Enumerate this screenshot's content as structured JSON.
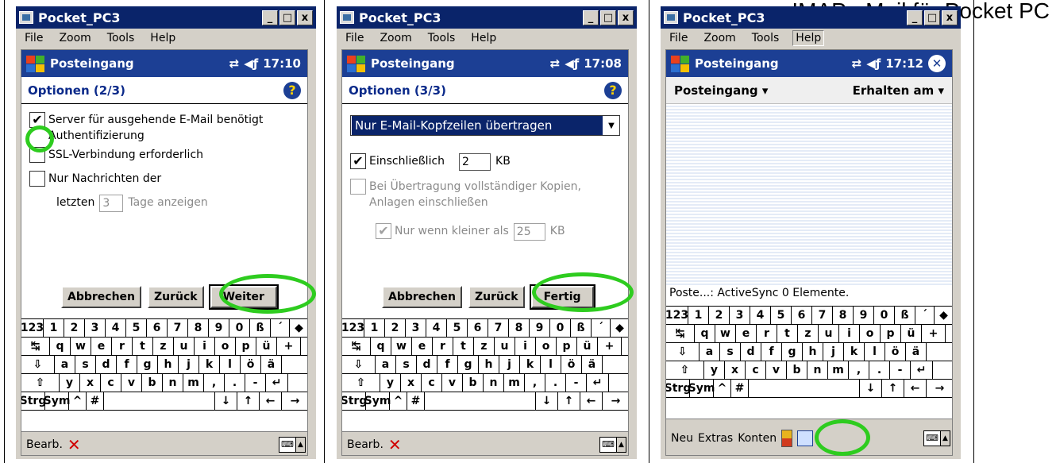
{
  "headline": "IMAP - Mail für Pocket PC",
  "window_title": "Pocket_PC3",
  "menu": [
    "File",
    "Zoom",
    "Tools",
    "Help"
  ],
  "win_buttons": [
    "_",
    "□",
    "x"
  ],
  "app": "Posteingang",
  "help_glyph": "?",
  "close_glyph": "✕",
  "keyboard": {
    "row1": [
      "123",
      "1",
      "2",
      "3",
      "4",
      "5",
      "6",
      "7",
      "8",
      "9",
      "0",
      "ß",
      "´",
      "◆"
    ],
    "row2": [
      "↹",
      "q",
      "w",
      "e",
      "r",
      "t",
      "z",
      "u",
      "i",
      "o",
      "p",
      "ü",
      "+"
    ],
    "row3": [
      "⇩",
      "a",
      "s",
      "d",
      "f",
      "g",
      "h",
      "j",
      "k",
      "l",
      "ö",
      "ä"
    ],
    "row4": [
      "⇧",
      "y",
      "x",
      "c",
      "v",
      "b",
      "n",
      "m",
      ",",
      ".",
      "-",
      "↵"
    ],
    "row5": [
      "Strg",
      "Sym",
      "^",
      "#",
      "",
      "↓",
      "↑",
      "←",
      "→"
    ]
  },
  "panes": [
    {
      "time": "17:10",
      "header": "Optionen (2/3)",
      "opt1": "Server für ausgehende E-Mail benötigt Authentifizierung",
      "opt1_checked": true,
      "opt2": "SSL-Verbindung erforderlich",
      "opt3": "Nur Nachrichten der",
      "days_prefix": "letzten",
      "days_value": "3",
      "days_suffix": "Tage anzeigen",
      "btn_cancel": "Abbrechen",
      "btn_back": "Zurück",
      "btn_next": "Weiter",
      "bottom_label": "Bearb.",
      "bottom_x": "✕"
    },
    {
      "time": "17:08",
      "header": "Optionen (3/3)",
      "select_value": "Nur E-Mail-Kopfzeilen übertragen",
      "incl_label": "Einschließlich",
      "incl_value": "2",
      "incl_unit": "KB",
      "incl_checked": true,
      "attach_label": "Bei Übertragung vollständiger Kopien, Anlagen einschließen",
      "smaller_label": "Nur wenn kleiner als",
      "smaller_value": "25",
      "smaller_unit": "KB",
      "btn_cancel": "Abbrechen",
      "btn_back": "Zurück",
      "btn_finish": "Fertig",
      "bottom_label": "Bearb.",
      "bottom_x": "✕"
    },
    {
      "time": "17:12",
      "folder": "Posteingang ▾",
      "sort": "Erhalten am ▾",
      "status": "Poste...: ActiveSync  0 Elemente.",
      "bottom_items": [
        "Neu",
        "Extras",
        "Konten"
      ]
    }
  ],
  "colors": {
    "highlight_ring": "#2ecc1f",
    "title_bar": "#0a246a",
    "nav_bar": "#1c3f94"
  }
}
